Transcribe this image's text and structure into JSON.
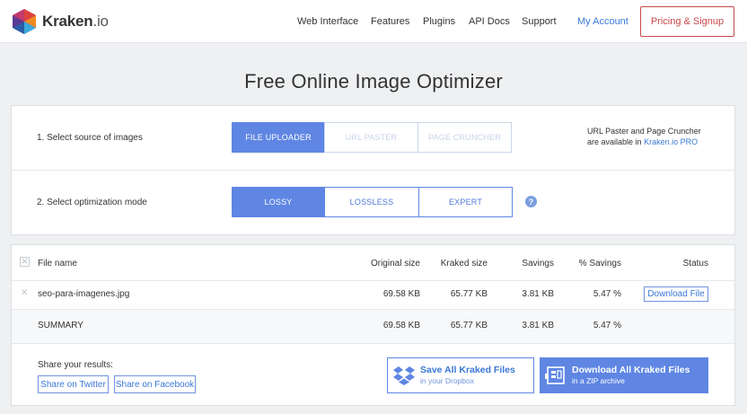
{
  "header": {
    "logo_main": "Kraken",
    "logo_suffix": ".io",
    "nav": [
      "Web Interface",
      "Features",
      "Plugins",
      "API Docs",
      "Support"
    ],
    "account": "My Account",
    "signup": "Pricing & Signup"
  },
  "page_title": "Free Online Image Optimizer",
  "source": {
    "label": "1. Select source of images",
    "options": [
      "FILE UPLOADER",
      "URL PASTER",
      "PAGE CRUNCHER"
    ],
    "selected": "FILE UPLOADER",
    "note_line1": "URL Paster and Page Cruncher",
    "note_line2_prefix": "are available in",
    "note_link": "Kraken.io PRO"
  },
  "mode": {
    "label": "2. Select optimization mode",
    "options": [
      "LOSSY",
      "LOSSLESS",
      "EXPERT"
    ],
    "selected": "LOSSY",
    "help_icon": "?"
  },
  "table": {
    "headers": {
      "file_name": "File name",
      "original": "Original size",
      "kraked": "Kraked size",
      "savings": "Savings",
      "pct": "% Savings",
      "status": "Status"
    },
    "rows": [
      {
        "file_name": "seo-para-imagenes.jpg",
        "original": "69.58 KB",
        "kraked": "65.77 KB",
        "savings": "3.81 KB",
        "pct": "5.47 %",
        "action": "Download File"
      }
    ],
    "summary": {
      "label": "SUMMARY",
      "original": "69.58 KB",
      "kraked": "65.77 KB",
      "savings": "3.81 KB",
      "pct": "5.47 %"
    }
  },
  "share": {
    "label": "Share your results:",
    "twitter": "Share on Twitter",
    "facebook": "Share on Facebook"
  },
  "actions": {
    "dropbox_title": "Save All Kraked Files",
    "dropbox_sub": "in your Dropbox",
    "zip_title": "Download All Kraked Files",
    "zip_sub": "in a ZIP archive"
  },
  "colors": {
    "accent": "#5f86e3",
    "link": "#3a78d6",
    "signup": "#c8494b"
  }
}
